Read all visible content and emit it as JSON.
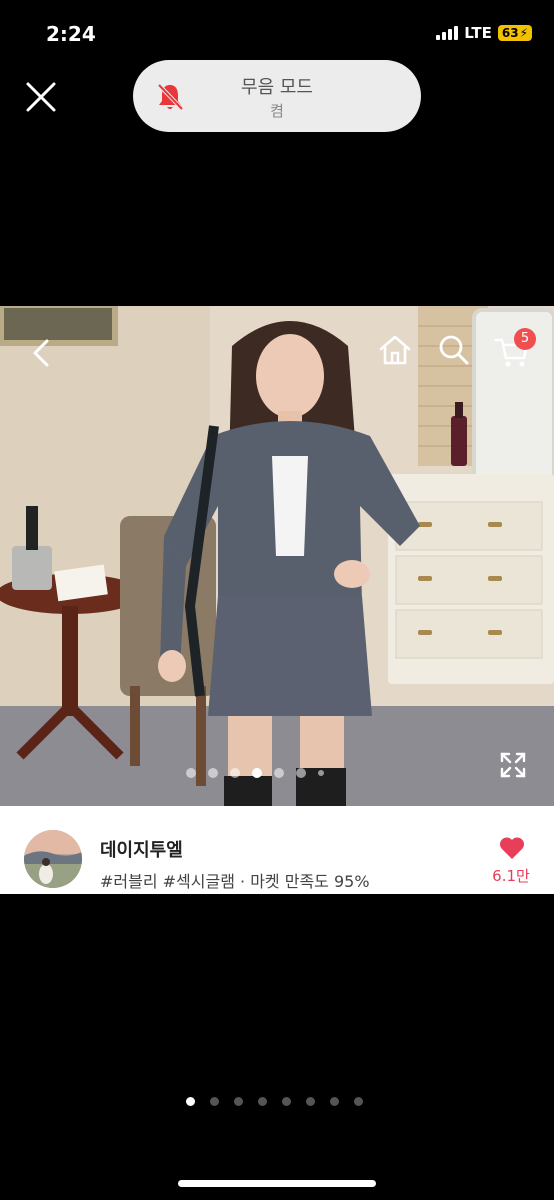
{
  "status_bar": {
    "time": "2:24",
    "network": "LTE",
    "battery": "63"
  },
  "silent_toast": {
    "title": "무음 모드",
    "subtitle": "켬"
  },
  "product": {
    "cart_count": "5",
    "image_index": 4,
    "image_count": 7
  },
  "seller": {
    "name": "데이지투엘",
    "tags": "#러블리 #섹시글램 · 마켓 만족도 95%",
    "likes": "6.1만"
  },
  "carousel": {
    "active_index": 0,
    "count": 8
  },
  "colors": {
    "accent": "#e83e5a",
    "badge": "#ef4f4f",
    "silent_icon": "#e8373a"
  }
}
